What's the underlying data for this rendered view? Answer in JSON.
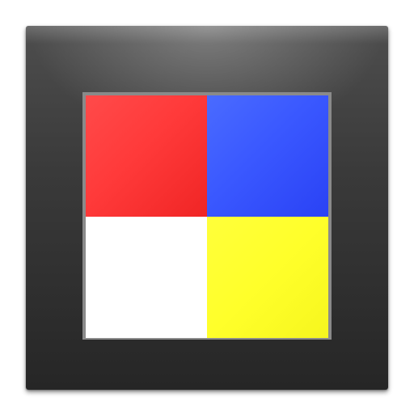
{
  "icon": {
    "name": "color-quadrant-app-icon",
    "tile_color": "#3a3a3a",
    "frame_color": "#8a8a8a",
    "cells": [
      {
        "id": "top-left",
        "color": "#ff3a3a"
      },
      {
        "id": "top-right",
        "color": "#3a58ff"
      },
      {
        "id": "bottom-left",
        "color": "#ffffff"
      },
      {
        "id": "bottom-right",
        "color": "#ffff2a"
      }
    ]
  }
}
